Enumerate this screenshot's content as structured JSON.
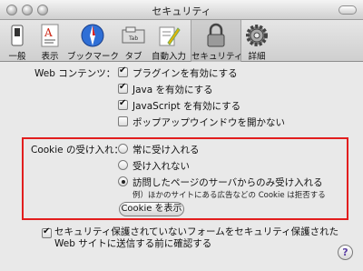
{
  "window": {
    "title": "セキュリティ"
  },
  "toolbar": {
    "items": [
      {
        "label": "一般",
        "icon": "switch-icon",
        "selected": false
      },
      {
        "label": "表示",
        "icon": "font-icon",
        "selected": false
      },
      {
        "label": "ブックマーク",
        "icon": "globe-icon",
        "selected": false
      },
      {
        "label": "タブ",
        "icon": "tab-icon",
        "selected": false
      },
      {
        "label": "自動入力",
        "icon": "pen-icon",
        "selected": false
      },
      {
        "label": "セキュリティ",
        "icon": "lock-icon",
        "selected": true
      },
      {
        "label": "詳細",
        "icon": "gear-icon",
        "selected": false
      }
    ]
  },
  "web_contents": {
    "label": "Web コンテンツ：",
    "options": [
      {
        "label": "プラグインを有効にする",
        "checked": true
      },
      {
        "label": "Java を有効にする",
        "checked": true
      },
      {
        "label": "JavaScript を有効にする",
        "checked": true
      },
      {
        "label": "ポップアップウインドウを開かない",
        "checked": false
      }
    ]
  },
  "cookies": {
    "label": "Cookie の受け入れ：",
    "options": [
      {
        "label": "常に受け入れる",
        "selected": false
      },
      {
        "label": "受け入れない",
        "selected": false
      },
      {
        "label": "訪問したページのサーバからのみ受け入れる",
        "selected": true
      }
    ],
    "note": "例）ほかのサイトにある広告などの Cookie は拒否する",
    "show_button": "Cookie を表示"
  },
  "insecure_forms": {
    "line1": "セキュリティ保護されていないフォームをセキュリティ保護された",
    "line2": "Web サイトに送信する前に確認する",
    "checked": true
  },
  "help": {
    "label": "?"
  },
  "colors": {
    "highlight_border": "#e21e1e"
  }
}
